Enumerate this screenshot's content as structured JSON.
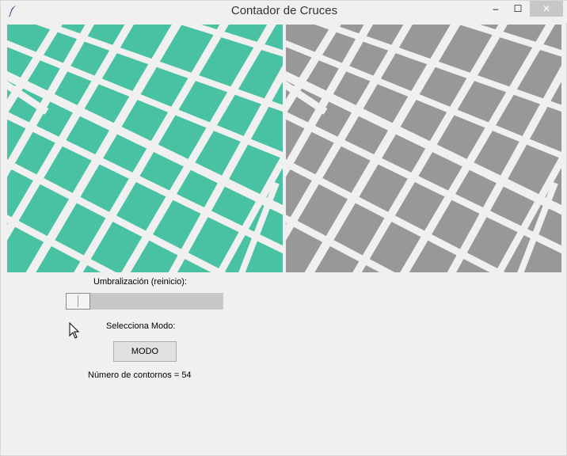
{
  "window": {
    "title": "Contador de Cruces",
    "controls": {
      "minimize": "–",
      "maximize": "☐",
      "close": "✕"
    }
  },
  "images": {
    "left_color": "#48c2a2",
    "right_color": "#989898",
    "road_color": "#f0f0f0"
  },
  "controls": {
    "threshold_label": "Umbralización (reinicio):",
    "threshold_value": 0,
    "mode_label": "Selecciona Modo:",
    "mode_button": "MODO",
    "contour_count_text": "Número de contornos = 54"
  },
  "icons": [
    "feather-icon",
    "minimize-icon",
    "maximize-icon",
    "close-icon",
    "mouse-cursor-icon"
  ]
}
